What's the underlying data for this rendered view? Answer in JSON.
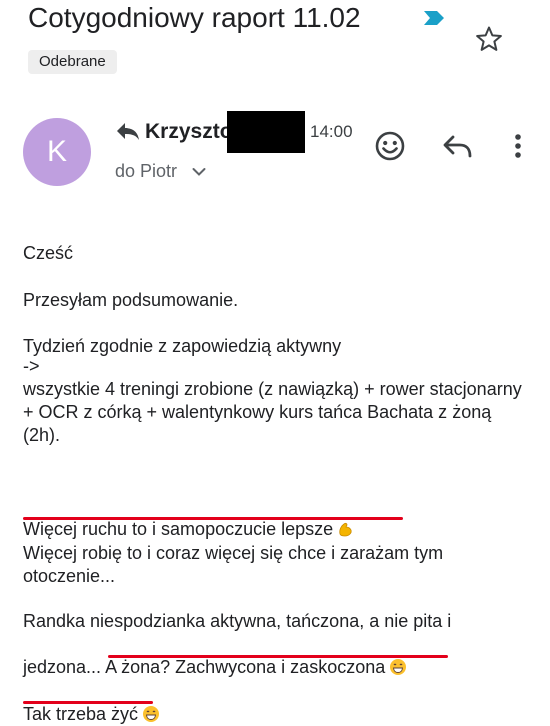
{
  "subject": {
    "title": "Cotygodniowy raport 11.02",
    "label": "Odebrane",
    "star": "star-outline-icon",
    "importance": "importance-marker-icon"
  },
  "sender": {
    "avatar_letter": "K",
    "avatar_color": "#bf9fdf",
    "name": "Krzyszto",
    "time": "14:00",
    "recipient_label": "do Piotr",
    "icons": [
      "reply-arrow-icon",
      "emoji-icon",
      "reply-icon",
      "more-vert-icon",
      "chevron-down-icon"
    ]
  },
  "body": {
    "greeting": "Cześć",
    "intro": "Przesyłam podsumowanie.",
    "week_line": "Tydzień zgodnie z zapowiedzią aktywny",
    "arrow": "->",
    "trainings": " wszystkie 4 treningi zrobione (z nawiązką) + rower stacjonarny + OCR z córką + walentynkowy kurs tańca Bachata z żoną (2h).",
    "highlight_1": "Więcej ruchu to i samopoczucie lepsze",
    "highlight_1_emoji": "flexed-biceps-emoji",
    "more_line": "Więcej robię to i coraz więcej się chce i zarażam tym otoczenie...",
    "date_line_a": "Randka niespodzianka aktywna, tańczona, a nie pita i",
    "date_line_b": "jedzona... ",
    "highlight_2": "A żona? Zachwycona i zaskoczona",
    "highlight_2_emoji": "grinning-face-emoji",
    "closing": "Tak trzeba żyć",
    "closing_emoji": "grinning-face-emoji",
    "underline_color": "#e3001b"
  }
}
